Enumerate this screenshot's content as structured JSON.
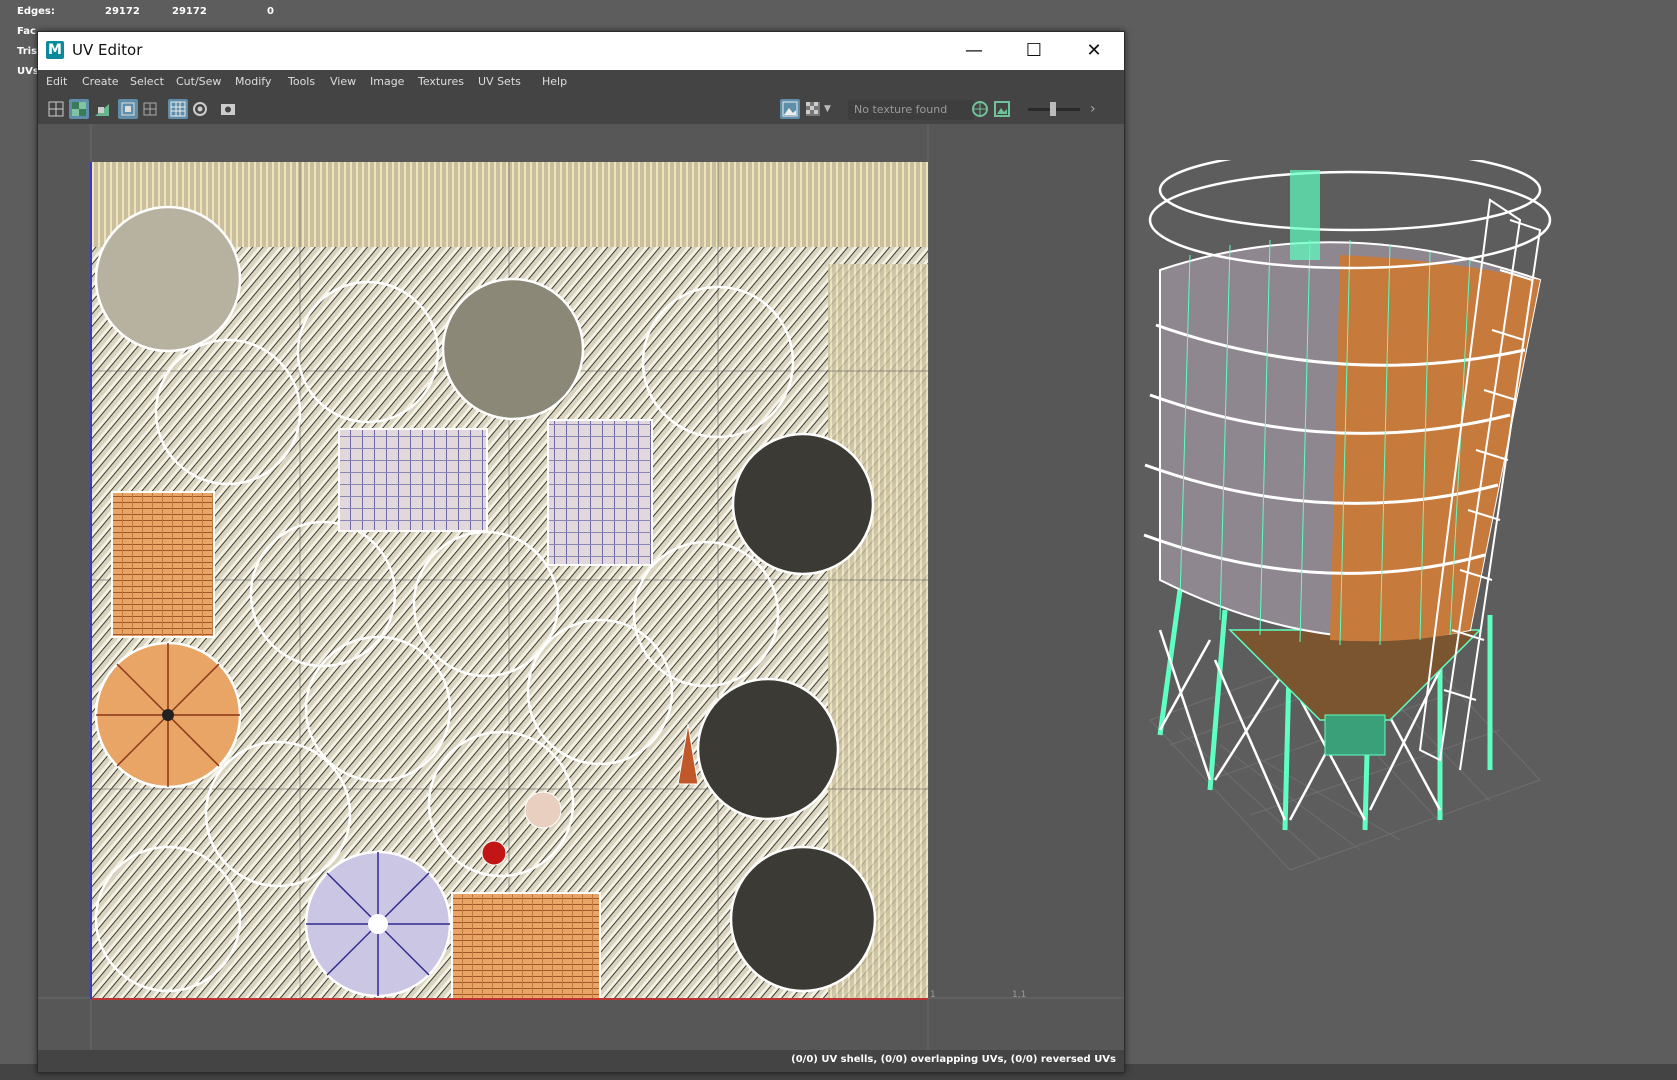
{
  "hud": {
    "rows": [
      {
        "label": "Edges:",
        "v1": "29172",
        "v2": "29172",
        "v3": "0"
      },
      {
        "label": "Fac",
        "v1": "",
        "v2": "",
        "v3": ""
      },
      {
        "label": "Tris",
        "v1": "",
        "v2": "",
        "v3": ""
      },
      {
        "label": "UVs",
        "v1": "",
        "v2": "",
        "v3": ""
      }
    ]
  },
  "window": {
    "title": "UV Editor",
    "logo": "M",
    "minimize_icon": "minimize-icon",
    "maximize_icon": "maximize-icon",
    "close_icon": "close-icon"
  },
  "menu": {
    "items": [
      "Edit",
      "Create",
      "Select",
      "Cut/Sew",
      "Modify",
      "Tools",
      "View",
      "Image",
      "Textures",
      "UV Sets",
      "Help"
    ]
  },
  "toolbar": {
    "texture_field": "No texture found"
  },
  "canvas": {
    "axis_label": "1,1",
    "axis_label_small": "1"
  },
  "status": {
    "text": "(0/0) UV shells, (0/0) overlapping UVs, (0/0) reversed UVs"
  },
  "colors": {
    "accent": "#5e8ea9",
    "wire": "#5effc0",
    "tank_orange": "#c67a3c",
    "tank_gray": "#8f8790",
    "uv_bg": "#d8d4c0"
  }
}
